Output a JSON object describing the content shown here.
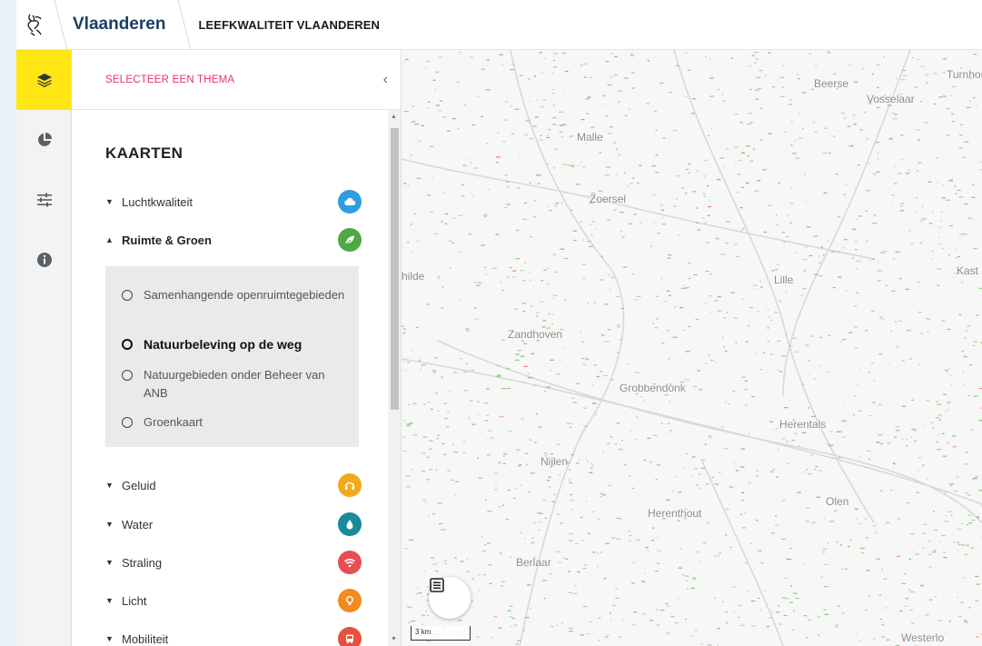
{
  "header": {
    "brand": "Vlaanderen",
    "app_title": "LEEFKWALITEIT VLAANDEREN",
    "logo_icon": "flemish-lion-icon"
  },
  "rail": {
    "items": [
      {
        "icon": "layers-icon",
        "active": true
      },
      {
        "icon": "pie-chart-icon",
        "active": false
      },
      {
        "icon": "sliders-icon",
        "active": false
      },
      {
        "icon": "info-icon",
        "active": false
      }
    ],
    "active_color": "#ffe615"
  },
  "panel": {
    "select_theme_label": "SELECTEER EEN THEMA",
    "collapse_icon": "chevron-left-icon",
    "section_title": "KAARTEN",
    "categories": [
      {
        "label": "Luchtkwaliteit",
        "expanded": false,
        "color": "#2d9fe0",
        "icon": "cloud-icon"
      },
      {
        "label": "Ruimte & Groen",
        "expanded": true,
        "color": "#4fa843",
        "icon": "leaf-icon"
      },
      {
        "label": "Geluid",
        "expanded": false,
        "color": "#f0a91a",
        "icon": "headphones-icon"
      },
      {
        "label": "Water",
        "expanded": false,
        "color": "#1a8a9a",
        "icon": "drop-icon"
      },
      {
        "label": "Straling",
        "expanded": false,
        "color": "#e54e55",
        "icon": "wifi-icon"
      },
      {
        "label": "Licht",
        "expanded": false,
        "color": "#f28a1c",
        "icon": "bulb-icon"
      },
      {
        "label": "Mobiliteit",
        "expanded": false,
        "color": "#e6523e",
        "icon": "bus-icon"
      }
    ],
    "sub_options": [
      {
        "label": "Samenhangende openruimtegebieden",
        "selected": false
      },
      {
        "label": "Natuurbeleving op de weg",
        "selected": true
      },
      {
        "label": "Natuurgebieden onder Beheer van ANB",
        "selected": false
      },
      {
        "label": "Groenkaart",
        "selected": false
      }
    ]
  },
  "map": {
    "places": [
      "Beerse",
      "Turnhout",
      "Vosselaar",
      "Malle",
      "Zoersel",
      "hilde",
      "Lille",
      "Kast",
      "Zandhoven",
      "Grobbendonk",
      "Herentals",
      "Nijlen",
      "Olen",
      "Herenthout",
      "Berlaar",
      "Westerlo"
    ],
    "scale_label": "3 km",
    "legend_icon": "legend-list-icon"
  }
}
